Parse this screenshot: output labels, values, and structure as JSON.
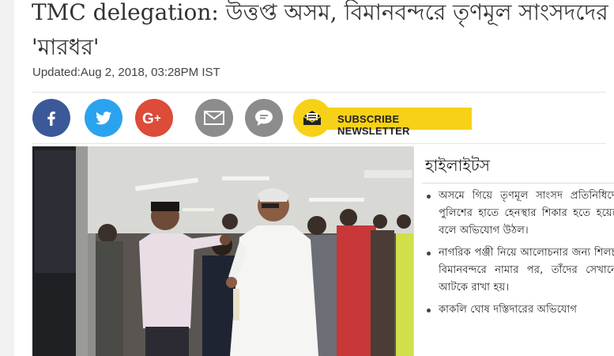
{
  "article": {
    "headline": "TMC delegation: উত্তপ্ত অসম, বিমানবন্দরে তৃণমূল সাংসদদের 'মারধর'",
    "updated": "Updated:Aug 2, 2018, 03:28PM IST"
  },
  "share": {
    "icons": [
      "facebook-icon",
      "twitter-icon",
      "google-plus-icon",
      "mail-icon",
      "comment-icon",
      "newsletter-icon"
    ],
    "newsletter_label": "SUBSCRIBE NEWSLETTER",
    "colors": {
      "facebook": "#3b5998",
      "twitter": "#2aa3ef",
      "google_plus": "#dd4b39",
      "grey": "#8c8c8c",
      "newsletter": "#f7d117"
    }
  },
  "highlights": {
    "title": "হাইলাইটস",
    "items": [
      "অসমে গিয়ে তৃণমূল সাংসদ প্রতিনিধিদের পুলিশের হাতে হেনস্থার শিকার হতে হয়েছে বলে অভিযোগ উঠল।",
      "নাগরিক পঞ্জী নিয়ে আলোচনার জন্য শিলচর বিমানবন্দরে নামার পর, তাঁদের সেখানেই আটকে রাখা হয়।",
      "কাকলি ঘোষ দস্তিদারের অভিযোগ"
    ]
  }
}
